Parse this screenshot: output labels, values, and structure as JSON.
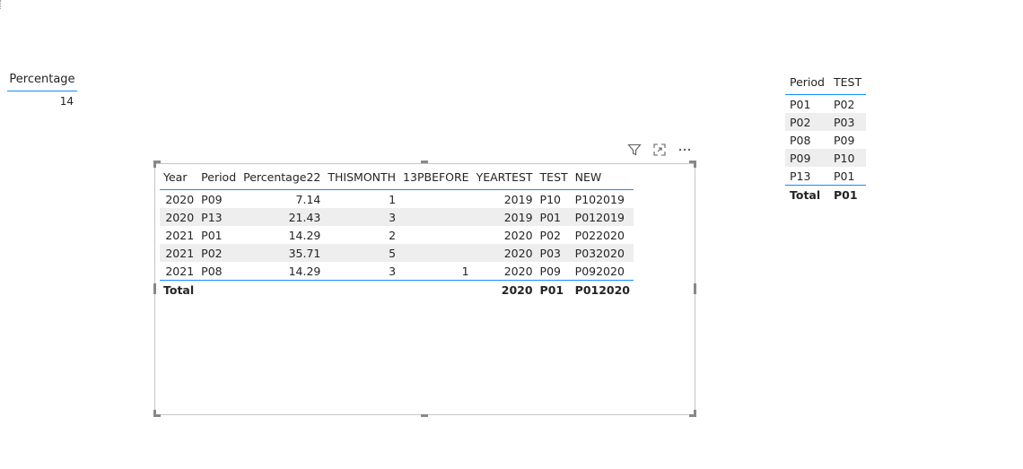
{
  "card": {
    "header": "Percentage",
    "value": "14"
  },
  "visual_header": {
    "icons": [
      "filter-icon",
      "focus-mode-icon",
      "more-options-icon"
    ]
  },
  "main_table": {
    "columns": [
      "Year",
      "Period",
      "Percentage22",
      "THISMONTH",
      "13PBEFORE",
      "YEARTEST",
      "TEST",
      "NEW"
    ],
    "rows": [
      [
        "2020",
        "P09",
        "7.14",
        "1",
        "",
        "2019",
        "P10",
        "P102019"
      ],
      [
        "2020",
        "P13",
        "21.43",
        "3",
        "",
        "2019",
        "P01",
        "P012019"
      ],
      [
        "2021",
        "P01",
        "14.29",
        "2",
        "",
        "2020",
        "P02",
        "P022020"
      ],
      [
        "2021",
        "P02",
        "35.71",
        "5",
        "",
        "2020",
        "P03",
        "P032020"
      ],
      [
        "2021",
        "P08",
        "14.29",
        "3",
        "1",
        "2020",
        "P09",
        "P092020"
      ]
    ],
    "total": [
      "Total",
      "",
      "",
      "",
      "",
      "2020",
      "P01",
      "P012020"
    ]
  },
  "side_table": {
    "columns": [
      "Period",
      "TEST"
    ],
    "rows": [
      [
        "P01",
        "P02"
      ],
      [
        "P02",
        "P03"
      ],
      [
        "P08",
        "P09"
      ],
      [
        "P09",
        "P10"
      ],
      [
        "P13",
        "P01"
      ]
    ],
    "total": [
      "Total",
      "P01"
    ]
  },
  "colors": {
    "accent": "#118dff",
    "band": "#eeeeee",
    "border": "#c8c6c4"
  }
}
